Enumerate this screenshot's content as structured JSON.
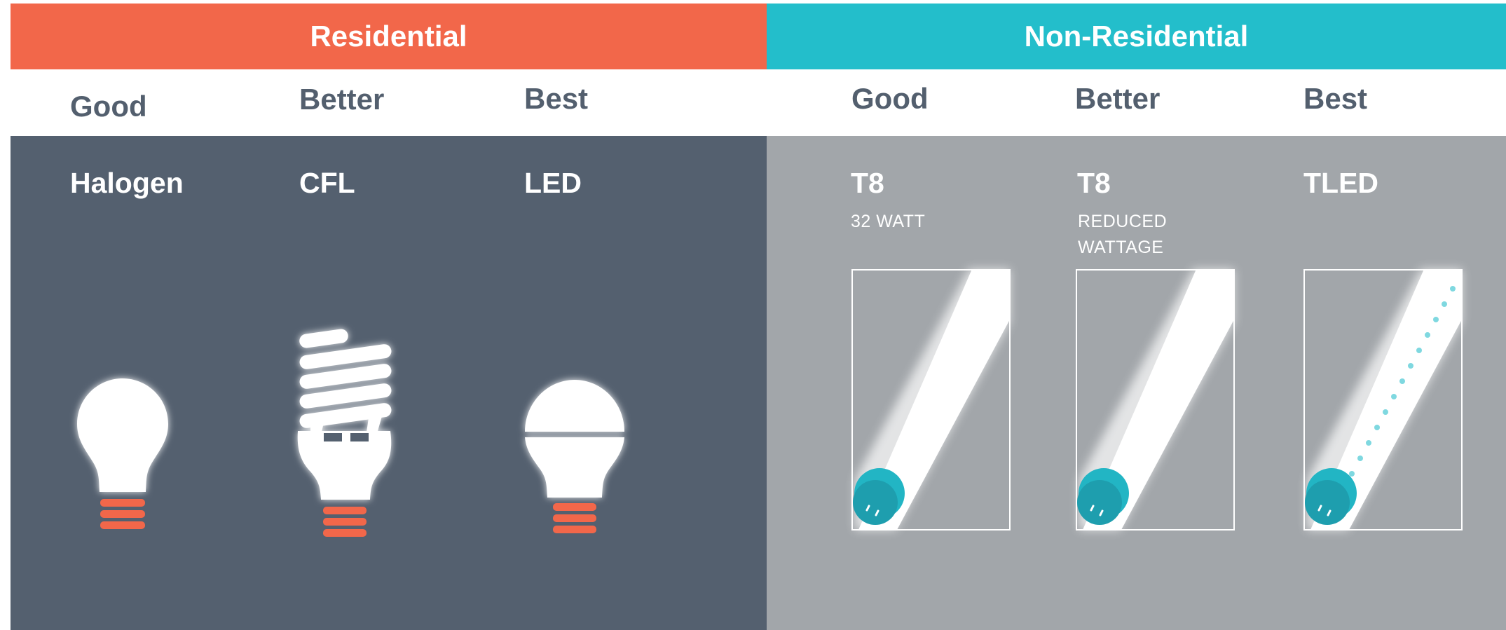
{
  "residential": {
    "heading": "Residential",
    "columns": [
      {
        "tier": "Good",
        "type": "Halogen",
        "icon": "halogen-bulb-icon"
      },
      {
        "tier": "Better",
        "type": "CFL",
        "icon": "cfl-bulb-icon"
      },
      {
        "tier": "Best",
        "type": "LED",
        "icon": "led-bulb-icon"
      }
    ]
  },
  "non_residential": {
    "heading": "Non-Residential",
    "columns": [
      {
        "tier": "Good",
        "type": "T8",
        "note": [
          "32 WATT"
        ],
        "icon": "t8-tube-icon"
      },
      {
        "tier": "Better",
        "type": "T8",
        "note": [
          "REDUCED",
          "WATTAGE"
        ],
        "icon": "t8-reduced-tube-icon"
      },
      {
        "tier": "Best",
        "type": "TLED",
        "icon": "tled-tube-icon"
      }
    ]
  },
  "colors": {
    "residential_accent": "#F2674A",
    "non_residential_accent": "#23BECB",
    "residential_panel": "#54606F",
    "non_residential_panel": "#A2A6AA",
    "tier_text": "#535F6E"
  }
}
